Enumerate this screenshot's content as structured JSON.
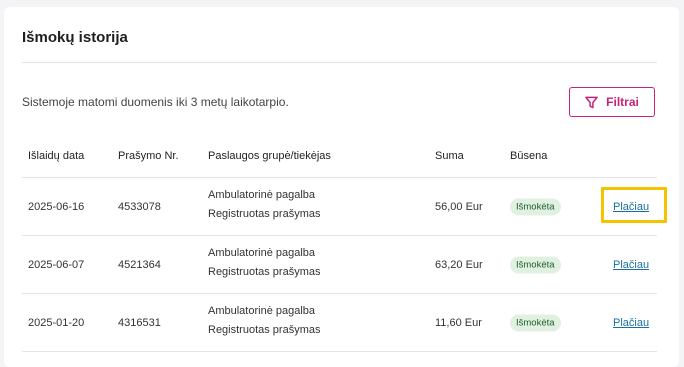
{
  "card": {
    "title": "Išmokų istorija",
    "intro": "Sistemoje matomi duomenis iki 3 metų laikotarpio.",
    "filter_label": "Filtrai"
  },
  "colors": {
    "accent": "#c8237a",
    "badge_bg": "#e0f1e2",
    "badge_text": "#1f5c2c",
    "link": "#1a6fa0",
    "highlight": "#f5c400"
  },
  "table": {
    "headers": {
      "date": "Išlaidų data",
      "request_no": "Prašymo Nr.",
      "service": "Paslaugos grupė/tiekėjas",
      "amount": "Suma",
      "status": "Būsena"
    },
    "rows": [
      {
        "date": "2025-06-16",
        "request_no": "4533078",
        "service_group": "Ambulatorinė pagalba",
        "provider": "Registruotas prašymas",
        "amount": "56,00 Eur",
        "status": "Išmokėta",
        "details": "Plačiau"
      },
      {
        "date": "2025-06-07",
        "request_no": "4521364",
        "service_group": "Ambulatorinė pagalba",
        "provider": "Registruotas prašymas",
        "amount": "63,20 Eur",
        "status": "Išmokėta",
        "details": "Plačiau"
      },
      {
        "date": "2025-01-20",
        "request_no": "4316531",
        "service_group": "Ambulatorinė pagalba",
        "provider": "Registruotas prašymas",
        "amount": "11,60 Eur",
        "status": "Išmokėta",
        "details": "Plačiau"
      }
    ]
  }
}
